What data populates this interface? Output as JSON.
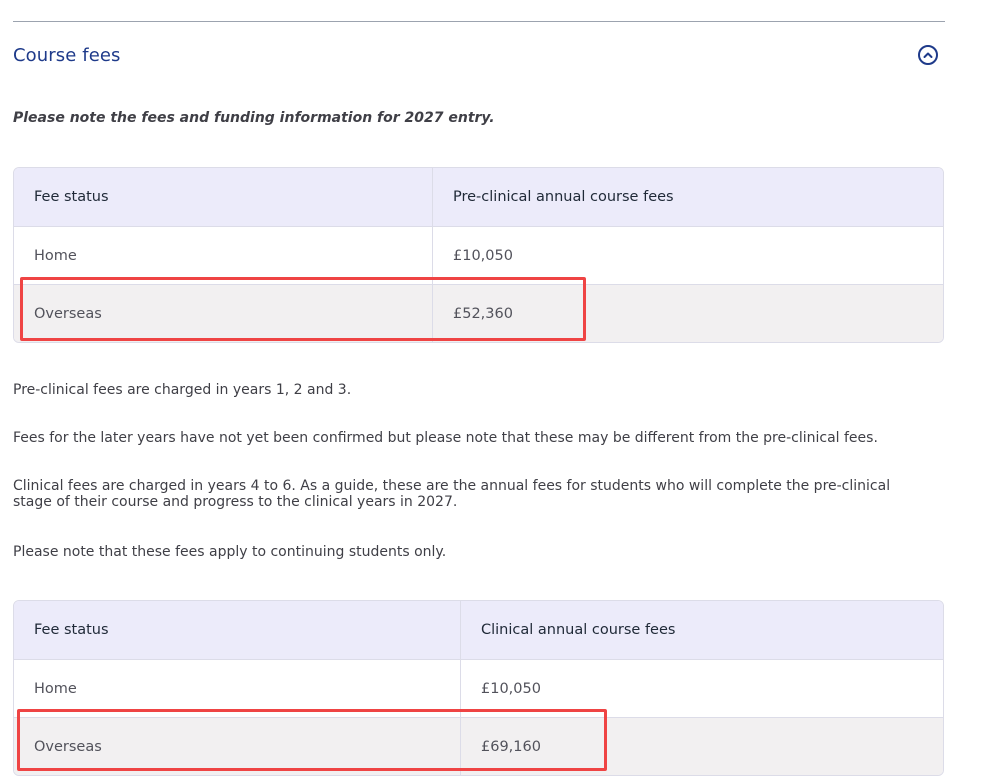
{
  "section": {
    "title": "Course fees",
    "note": "Please note the fees and funding information for 2027 entry."
  },
  "preclinical_table": {
    "headers": [
      "Fee status",
      "Pre-clinical annual course fees"
    ],
    "rows": [
      [
        "Home",
        "£10,050"
      ],
      [
        "Overseas",
        "£52,360"
      ]
    ]
  },
  "paragraphs": [
    "Pre-clinical fees are charged in years 1, 2 and 3.",
    "Fees for the later years have not yet been confirmed but please note that these may be different from the pre-clinical fees.",
    "Clinical fees are charged in years 4 to 6. As a guide, these are the annual fees for students who will complete the pre-clinical stage of their course and progress to the clinical years in 2027.",
    "Please note that these fees apply to continuing students only."
  ],
  "clinical_table": {
    "headers": [
      "Fee status",
      "Clinical annual course fees"
    ],
    "rows": [
      [
        "Home",
        "£10,050"
      ],
      [
        "Overseas",
        "£69,160"
      ]
    ]
  },
  "icons": {
    "toggle": "chevron-up-circle-icon"
  },
  "colors": {
    "accent": "#1e3a8a",
    "highlight": "#ef4444",
    "header_bg": "#ecebfa",
    "alt_row_bg": "#f2f0f1"
  }
}
